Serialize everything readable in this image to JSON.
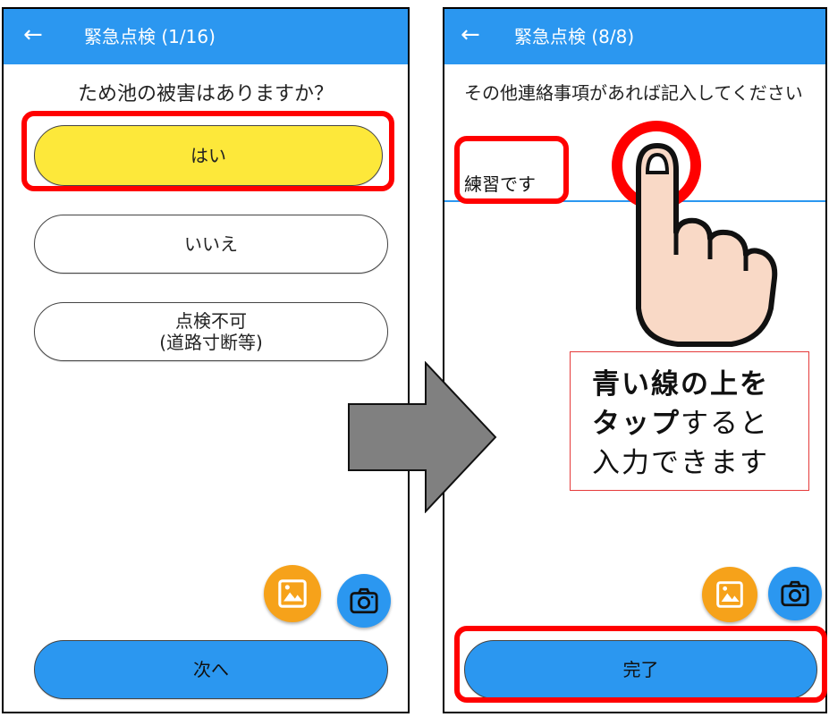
{
  "left_screen": {
    "title": "緊急点検 (1/16)",
    "back_icon": "←",
    "question": "ため池の被害はありますか？",
    "options": [
      {
        "label": "はい",
        "selected": true
      },
      {
        "label": "いいえ",
        "selected": false
      },
      {
        "label_line1": "点検不可",
        "label_line2": "(道路寸断等)",
        "selected": false
      }
    ],
    "next_label": "次へ",
    "fabs": [
      "image-icon",
      "camera-icon"
    ]
  },
  "right_screen": {
    "title": "緊急点検 (8/8)",
    "back_icon": "←",
    "prompt": "その他連絡事項があれば記入してください",
    "input_value": "練習です",
    "finish_label": "完了",
    "fabs": [
      "image-icon",
      "camera-icon"
    ]
  },
  "callout": {
    "bold1": "青い線の上を",
    "bold2": "タップ",
    "normal2": "すると",
    "line3": "入力できます"
  },
  "colors": {
    "appbar": "#2b97f0",
    "selected": "#fde83a",
    "highlight": "#ff0000",
    "fab_orange": "#f6a21a"
  },
  "icons": [
    "back-arrow-icon",
    "image-icon",
    "camera-icon",
    "right-arrow-icon",
    "pointing-hand-icon"
  ]
}
